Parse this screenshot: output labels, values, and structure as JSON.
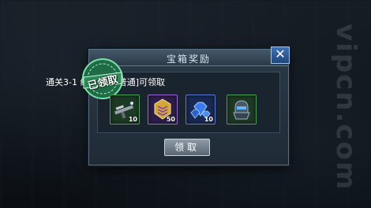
{
  "watermark": "vipcn.com",
  "dialog": {
    "title": "宝箱奖励",
    "close_label": "✕",
    "badge_text": "已领取",
    "condition": "通关3-1 绝密档案[普通]可领取",
    "items": [
      {
        "icon": "sniper-rifle-icon",
        "qty": "10",
        "color": "#3f8a4a"
      },
      {
        "icon": "rank-medal-icon",
        "qty": "50",
        "color": "#6a3fa8"
      },
      {
        "icon": "blue-gem-icon",
        "qty": "10",
        "color": "#2e4f9c"
      },
      {
        "icon": "armor-helmet-icon",
        "qty": "",
        "color": "#3f8a4a"
      }
    ],
    "claim_label": "领取"
  }
}
